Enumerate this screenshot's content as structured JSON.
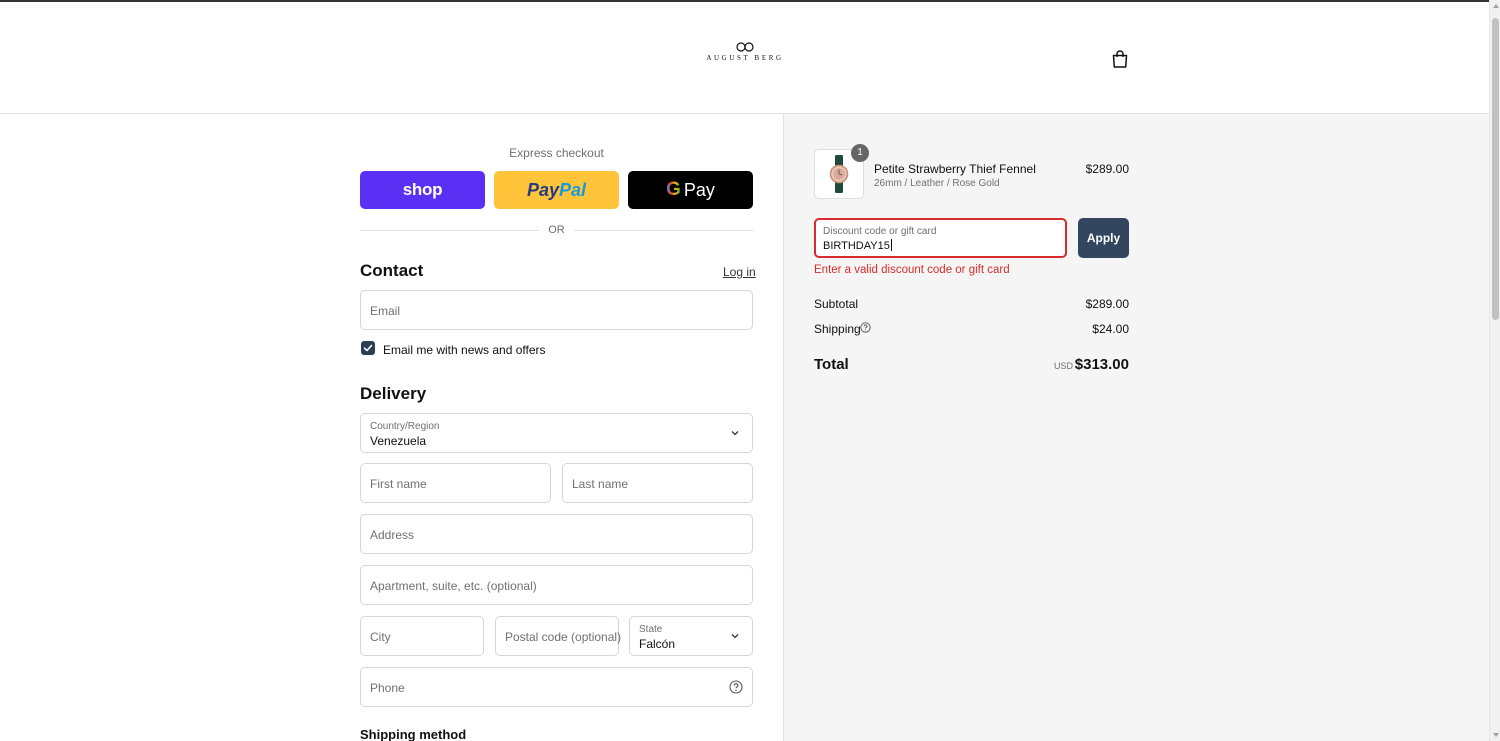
{
  "brand": {
    "name": "AUGUST BERG"
  },
  "express": {
    "title": "Express checkout",
    "shop_label": "shop",
    "paypal_label_a": "Pay",
    "paypal_label_b": "Pal",
    "gpay_g": "G",
    "gpay_label": "Pay",
    "or_label": "OR"
  },
  "contact": {
    "title": "Contact",
    "login_label": "Log in",
    "email_placeholder": "Email",
    "newsletter_label": "Email me with news and offers",
    "newsletter_checked": true
  },
  "delivery": {
    "title": "Delivery",
    "country_label": "Country/Region",
    "country_value": "Venezuela",
    "first_name_placeholder": "First name",
    "last_name_placeholder": "Last name",
    "address_placeholder": "Address",
    "apartment_placeholder": "Apartment, suite, etc. (optional)",
    "city_placeholder": "City",
    "postal_placeholder": "Postal code (optional)",
    "state_label": "State",
    "state_value": "Falcón",
    "phone_placeholder": "Phone"
  },
  "shipping_method": {
    "title": "Shipping method"
  },
  "order": {
    "item": {
      "name": "Petite Strawberry Thief Fennel",
      "variant": "26mm / Leather / Rose Gold",
      "price": "$289.00",
      "quantity": "1"
    },
    "discount": {
      "label": "Discount code or gift card",
      "value": "BIRTHDAY15",
      "apply_label": "Apply",
      "error": "Enter a valid discount code or gift card"
    },
    "subtotal_label": "Subtotal",
    "subtotal_value": "$289.00",
    "shipping_label": "Shipping",
    "shipping_value": "$24.00",
    "total_label": "Total",
    "total_currency": "USD",
    "total_value": "$313.00"
  },
  "colors": {
    "shop_purple": "#5a31f4",
    "paypal_yellow": "#ffc439",
    "apply_button": "#32475f",
    "error_red": "#d72c2c",
    "checkbox": "#2b3d57"
  },
  "icons": [
    "cart-icon",
    "chevron-down-icon",
    "help-circle-icon",
    "checkmark-icon",
    "watch-thumbnail"
  ]
}
